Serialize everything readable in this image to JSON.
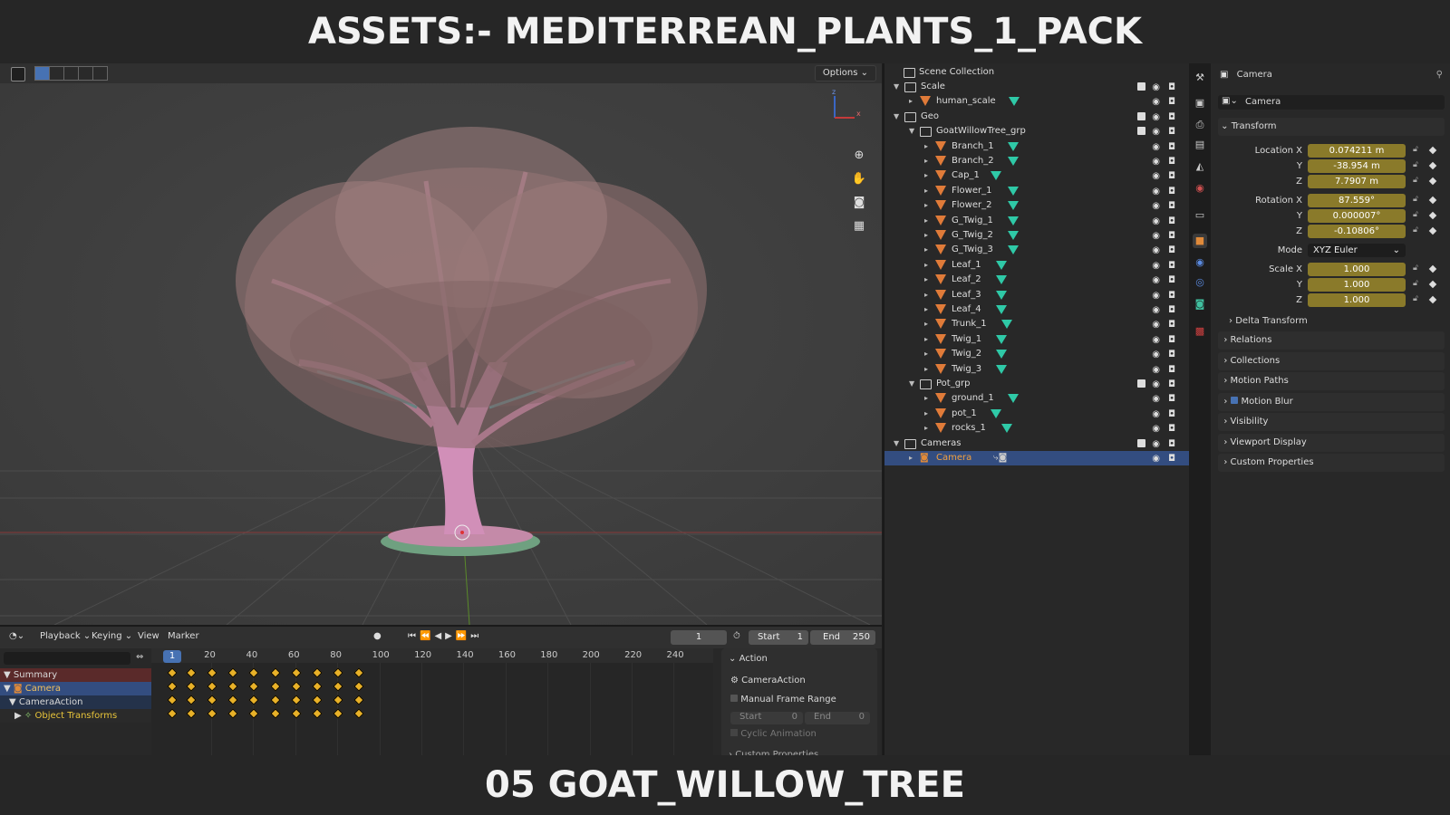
{
  "banner": {
    "top": "ASSETS:- MEDITERREAN_PLANTS_1_PACK",
    "bottom": "05 GOAT_WILLOW_TREE"
  },
  "viewport": {
    "options_label": "Options",
    "tools": [
      "zoom-icon",
      "hand-icon",
      "camera-icon",
      "grid-icon"
    ],
    "gizmo": {
      "z": "z",
      "x": "x"
    }
  },
  "timeline": {
    "menu": [
      "Playback",
      "Keying",
      "View",
      "Marker"
    ],
    "current_frame": "1",
    "start_label": "Start",
    "start_value": "1",
    "end_label": "End",
    "end_value": "250",
    "ruler": [
      "1",
      "20",
      "40",
      "60",
      "80",
      "100",
      "120",
      "140",
      "160",
      "180",
      "200",
      "220",
      "240"
    ],
    "channels": [
      "Summary",
      "Camera",
      "CameraAction",
      "Object Transforms"
    ],
    "keyframes": [
      1,
      10,
      20,
      30,
      40,
      50,
      60,
      70,
      80,
      90
    ]
  },
  "action_panel": {
    "title": "Action",
    "action_name": "CameraAction",
    "manual_frame_range": "Manual Frame Range",
    "start_label": "Start",
    "start_value": "0",
    "end_label": "End",
    "end_value": "0",
    "cyclic": "Cyclic Animation",
    "custom": "Custom Properties"
  },
  "outliner": {
    "scene_collection": "Scene Collection",
    "rows": [
      {
        "label": "Scale",
        "type": "collection",
        "depth": 0
      },
      {
        "label": "human_scale",
        "type": "mesh",
        "depth": 1
      },
      {
        "label": "Geo",
        "type": "collection",
        "depth": 0
      },
      {
        "label": "GoatWillowTree_grp",
        "type": "collection",
        "depth": 1
      },
      {
        "label": "Branch_1",
        "type": "mesh",
        "depth": 2
      },
      {
        "label": "Branch_2",
        "type": "mesh",
        "depth": 2
      },
      {
        "label": "Cap_1",
        "type": "mesh",
        "depth": 2
      },
      {
        "label": "Flower_1",
        "type": "mesh",
        "depth": 2
      },
      {
        "label": "Flower_2",
        "type": "mesh",
        "depth": 2
      },
      {
        "label": "G_Twig_1",
        "type": "mesh",
        "depth": 2
      },
      {
        "label": "G_Twig_2",
        "type": "mesh",
        "depth": 2
      },
      {
        "label": "G_Twig_3",
        "type": "mesh",
        "depth": 2
      },
      {
        "label": "Leaf_1",
        "type": "mesh",
        "depth": 2
      },
      {
        "label": "Leaf_2",
        "type": "mesh",
        "depth": 2
      },
      {
        "label": "Leaf_3",
        "type": "mesh",
        "depth": 2
      },
      {
        "label": "Leaf_4",
        "type": "mesh",
        "depth": 2
      },
      {
        "label": "Trunk_1",
        "type": "mesh",
        "depth": 2
      },
      {
        "label": "Twig_1",
        "type": "mesh",
        "depth": 2
      },
      {
        "label": "Twig_2",
        "type": "mesh",
        "depth": 2
      },
      {
        "label": "Twig_3",
        "type": "mesh",
        "depth": 2
      },
      {
        "label": "Pot_grp",
        "type": "collection",
        "depth": 1
      },
      {
        "label": "ground_1",
        "type": "mesh",
        "depth": 2
      },
      {
        "label": "pot_1",
        "type": "mesh",
        "depth": 2
      },
      {
        "label": "rocks_1",
        "type": "mesh",
        "depth": 2
      },
      {
        "label": "Cameras",
        "type": "collection",
        "depth": 0
      },
      {
        "label": "Camera",
        "type": "camera",
        "depth": 1
      }
    ]
  },
  "properties": {
    "header_title": "Camera",
    "object_name": "Camera",
    "transform_label": "Transform",
    "location_label": "Location X",
    "rotation_label": "Rotation X",
    "scale_label": "Scale X",
    "axis_y": "Y",
    "axis_z": "Z",
    "location": [
      "0.074211 m",
      "-38.954 m",
      "7.7907 m"
    ],
    "rotation": [
      "87.559°",
      "0.000007°",
      "-0.10806°"
    ],
    "mode_label": "Mode",
    "mode_value": "XYZ Euler",
    "scale": [
      "1.000",
      "1.000",
      "1.000"
    ],
    "delta": "Delta Transform",
    "sections": [
      "Relations",
      "Collections",
      "Motion Paths",
      "Motion Blur",
      "Visibility",
      "Viewport Display",
      "Custom Properties"
    ]
  },
  "colors": {
    "accent": "#4772b3",
    "keyframe": "#e8b128",
    "field_animated": "#8a7a2a",
    "mesh": "#e07b39",
    "meshdata": "#2fc9a7"
  }
}
